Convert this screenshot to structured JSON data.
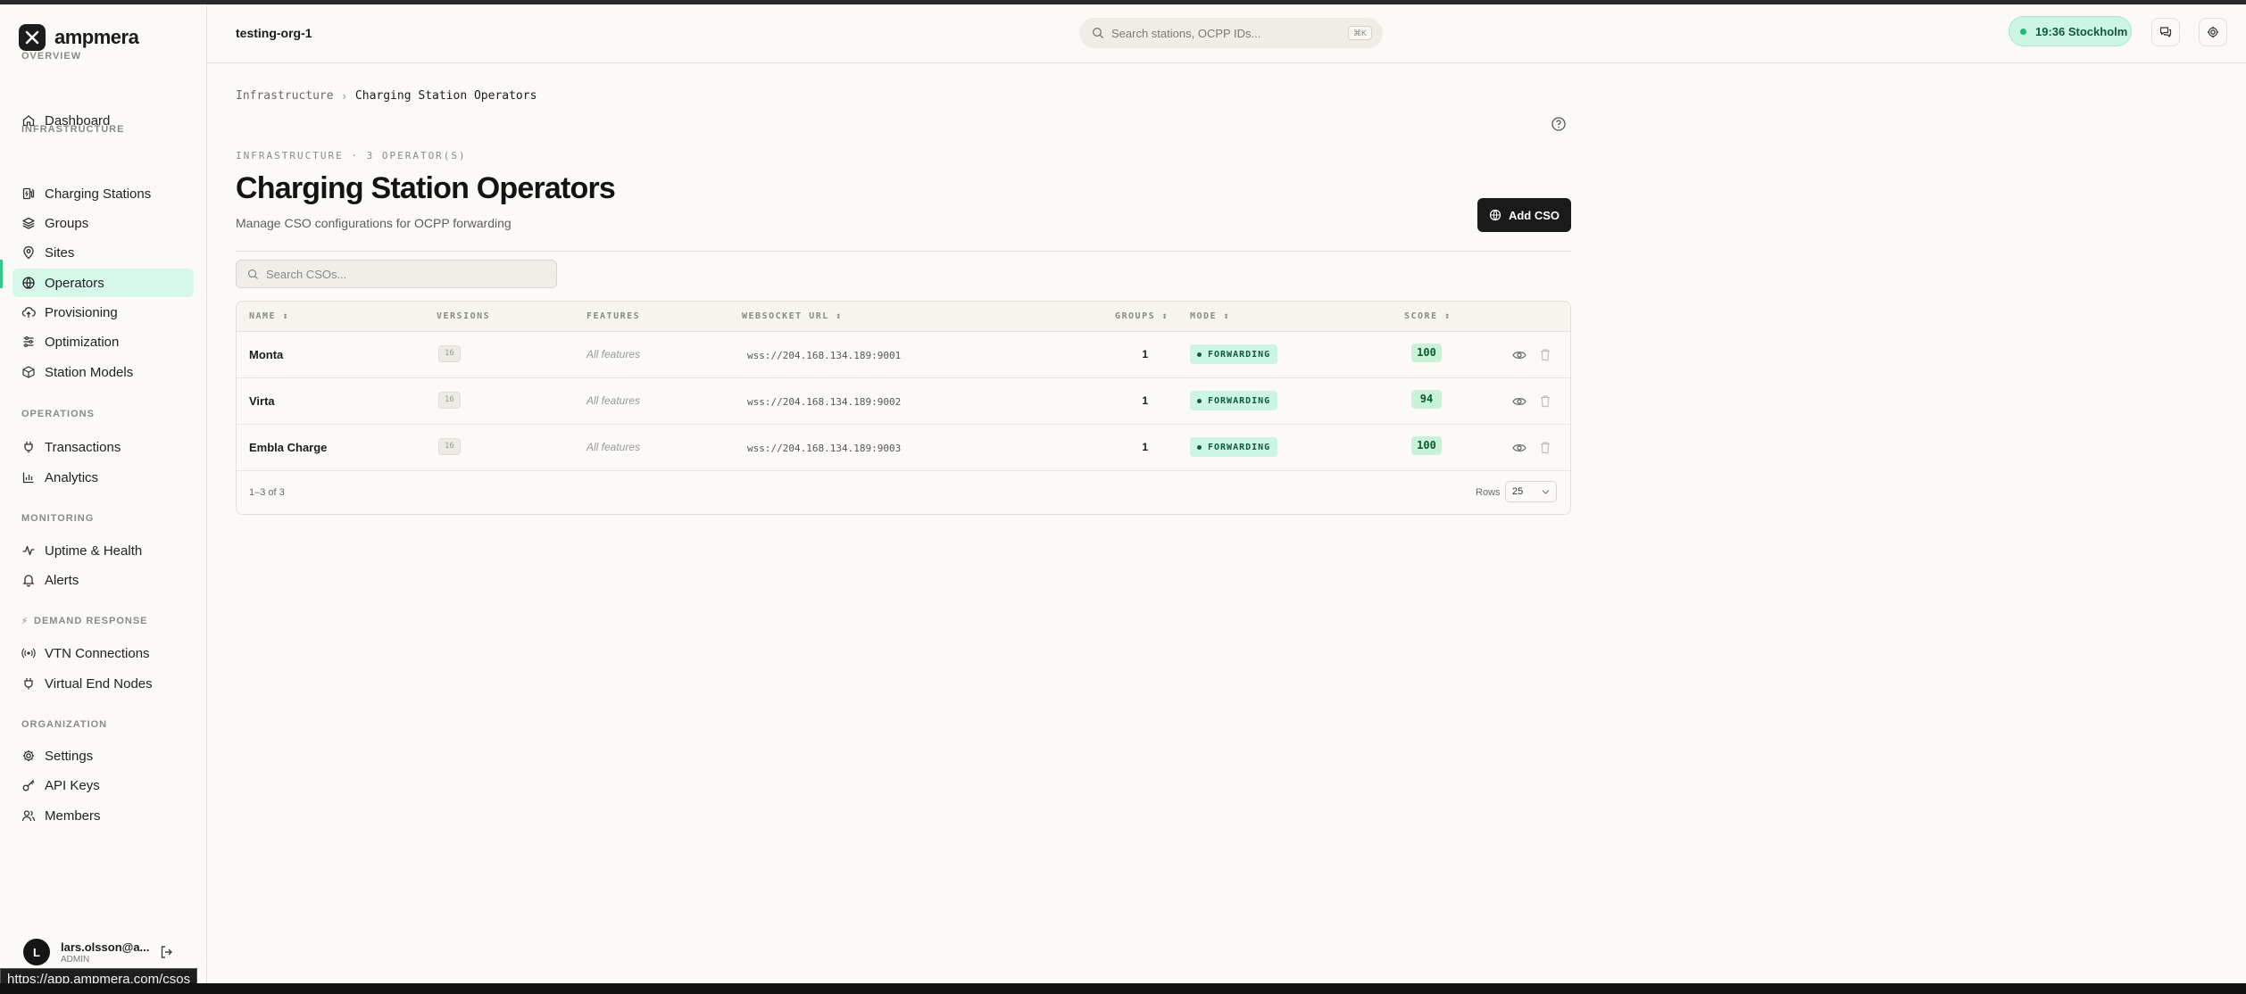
{
  "app": {
    "name": "ampmera",
    "org": "testing-org-1",
    "status_url": "https://app.ampmera.com/csos"
  },
  "header": {
    "search_placeholder": "Search stations, OCPP IDs...",
    "search_shortcut": "⌘K",
    "clock": "19:36 Stockholm"
  },
  "sidebar": {
    "sections": [
      {
        "title": "OVERVIEW",
        "items": [
          {
            "label": "Dashboard",
            "icon": "home-icon"
          }
        ]
      },
      {
        "title": "INFRASTRUCTURE",
        "items": [
          {
            "label": "Charging Stations",
            "icon": "charging-station-icon"
          },
          {
            "label": "Groups",
            "icon": "layers-icon"
          },
          {
            "label": "Sites",
            "icon": "map-pin-icon"
          },
          {
            "label": "Operators",
            "icon": "globe-icon",
            "active": true
          },
          {
            "label": "Provisioning",
            "icon": "cloud-upload-icon"
          },
          {
            "label": "Optimization",
            "icon": "sliders-icon"
          },
          {
            "label": "Station Models",
            "icon": "box-icon"
          }
        ]
      },
      {
        "title": "OPERATIONS",
        "items": [
          {
            "label": "Transactions",
            "icon": "plug-icon"
          },
          {
            "label": "Analytics",
            "icon": "bar-chart-icon"
          }
        ]
      },
      {
        "title": "MONITORING",
        "items": [
          {
            "label": "Uptime & Health",
            "icon": "activity-icon"
          },
          {
            "label": "Alerts",
            "icon": "bell-icon"
          }
        ]
      },
      {
        "title": "DEMAND RESPONSE",
        "items": [
          {
            "label": "VTN Connections",
            "icon": "radio-icon"
          },
          {
            "label": "Virtual End Nodes",
            "icon": "plug-icon"
          }
        ]
      },
      {
        "title": "ORGANIZATION",
        "items": [
          {
            "label": "Settings",
            "icon": "gear-icon"
          },
          {
            "label": "API Keys",
            "icon": "key-icon"
          },
          {
            "label": "Members",
            "icon": "users-icon"
          }
        ]
      }
    ],
    "user": {
      "initial": "L",
      "email": "lars.olsson@a...",
      "role": "ADMIN"
    }
  },
  "page": {
    "breadcrumb": [
      "Infrastructure",
      "Charging Station Operators"
    ],
    "eyebrow": "INFRASTRUCTURE · 3 OPERATOR(S)",
    "title": "Charging Station Operators",
    "subtitle": "Manage CSO configurations for OCPP forwarding",
    "add_button": "Add CSO",
    "search_placeholder": "Search CSOs..."
  },
  "table": {
    "headers": {
      "name": "NAME ↕",
      "versions": "VERSIONS",
      "features": "FEATURES",
      "url": "WEBSOCKET URL ↕",
      "groups": "GROUPS ↕",
      "mode": "MODE ↕",
      "score": "SCORE ↕"
    },
    "rows": [
      {
        "name": "Monta",
        "version": "16",
        "features": "All features",
        "url": "wss://204.168.134.189:9001",
        "groups": "1",
        "mode": "FORWARDING",
        "score": "100"
      },
      {
        "name": "Virta",
        "version": "16",
        "features": "All features",
        "url": "wss://204.168.134.189:9002",
        "groups": "1",
        "mode": "FORWARDING",
        "score": "94"
      },
      {
        "name": "Embla Charge",
        "version": "16",
        "features": "All features",
        "url": "wss://204.168.134.189:9003",
        "groups": "1",
        "mode": "FORWARDING",
        "score": "100"
      }
    ],
    "count": "1–3 of 3",
    "rows_label": "Rows",
    "rows_value": "25"
  },
  "colors": {
    "accent": "#35c98a",
    "accent_bg": "#d6f8ea",
    "dark": "#1a1a1a",
    "background": "#fbfaf6"
  }
}
